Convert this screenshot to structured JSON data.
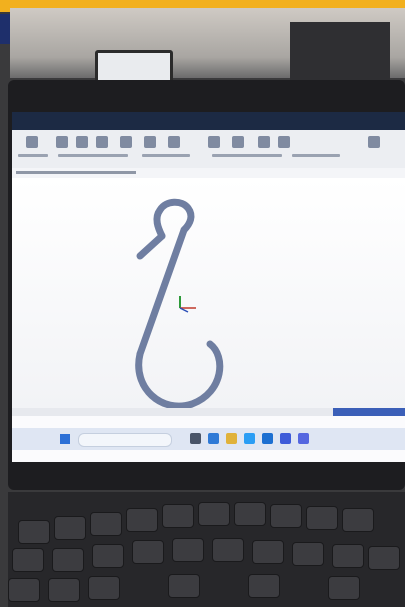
{
  "photo": {
    "colors": {
      "banner": "#f2b01e",
      "logo": "#1e2f6b",
      "bezel": "#1d1d20",
      "hook_stroke": "#6f7ea1",
      "taskbar": "#dfe6f3"
    },
    "icons": [
      "cad-sketch-hook",
      "origin-triad-icon",
      "windows-start-icon",
      "search-icon",
      "taskbar-app-icons",
      "keyboard-keys"
    ]
  }
}
